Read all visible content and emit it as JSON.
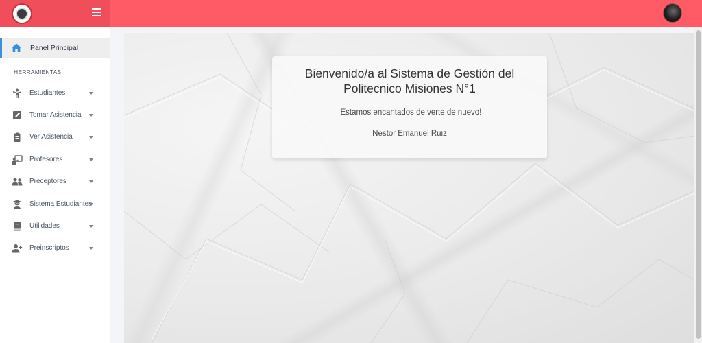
{
  "header": {
    "logo": "school-seal-logo",
    "menu_icon": "hamburger-icon",
    "avatar": "user-avatar"
  },
  "sidebar": {
    "active_item": {
      "label": "Panel Principal",
      "icon": "home-icon"
    },
    "section_title": "HERRAMIENTAS",
    "items": [
      {
        "label": "Estudiantes",
        "icon": "student-icon"
      },
      {
        "label": "Tomar Asistencia",
        "icon": "pencil-icon"
      },
      {
        "label": "Ver Asistencia",
        "icon": "clipboard-icon"
      },
      {
        "label": "Profesores",
        "icon": "teacher-board-icon"
      },
      {
        "label": "Preceptores",
        "icon": "users-icon"
      },
      {
        "label": "Sistema Estudiantes",
        "icon": "graduate-icon"
      },
      {
        "label": "Utilidades",
        "icon": "book-icon"
      },
      {
        "label": "Preinscriptos",
        "icon": "user-plus-icon"
      }
    ]
  },
  "welcome": {
    "title": "Bienvenido/a al Sistema de Gestión del Politecnico Misiones N°1",
    "subtitle": "¡Estamos encantados de verte de nuevo!",
    "user_name": "Nestor Emanuel Ruiz"
  },
  "colors": {
    "topbar": "#fe5b67",
    "brand": "#f14e5b",
    "active_accent": "#3c8dda"
  }
}
